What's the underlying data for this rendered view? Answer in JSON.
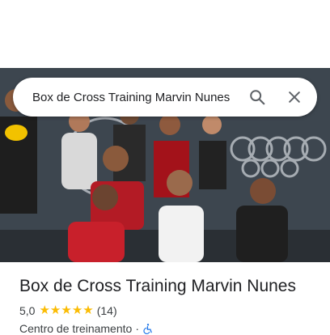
{
  "search": {
    "query": "Box de Cross Training Marvin Nunes"
  },
  "place": {
    "name": "Box de Cross Training Marvin Nunes",
    "rating": "5,0",
    "review_count": "(14)",
    "category": "Centro de treinamento",
    "separator": "·"
  },
  "icons": {
    "search": "search-icon",
    "close": "close-icon",
    "accessibility": "wheelchair-accessible-icon"
  },
  "colors": {
    "star": "#fbbc04",
    "accessibility": "#1a73e8"
  }
}
